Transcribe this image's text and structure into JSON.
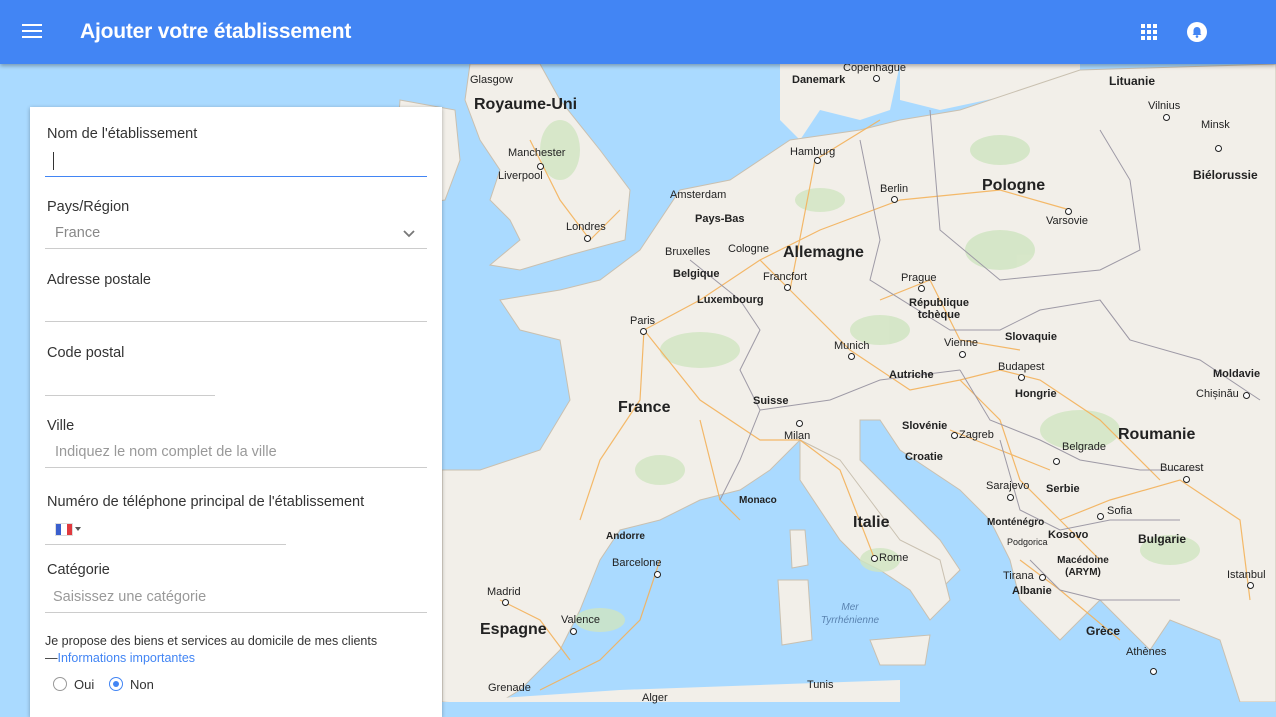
{
  "header": {
    "title": "Ajouter votre établissement",
    "menu_icon": "hamburger-menu-icon",
    "apps_icon": "apps-grid-icon",
    "notification_icon": "notification-bell-icon",
    "bar_color": "#4285f4"
  },
  "form": {
    "name": {
      "label": "Nom de l'établissement",
      "value": ""
    },
    "country": {
      "label": "Pays/Région",
      "value": "France",
      "icon": "chevron-down-icon"
    },
    "address": {
      "label": "Adresse postale",
      "value": ""
    },
    "postal": {
      "label": "Code postal",
      "value": ""
    },
    "city": {
      "label": "Ville",
      "placeholder": "Indiquez le nom complet de la ville"
    },
    "phone": {
      "label": "Numéro de téléphone principal de l'établissement",
      "flag_icon": "france-flag-icon"
    },
    "category": {
      "label": "Catégorie",
      "placeholder": "Saisissez une catégorie"
    },
    "service_area": {
      "text": "Je propose des biens et services au domicile de mes clients",
      "prefix": "—",
      "link": "Informations importantes",
      "options": [
        {
          "label": "Oui",
          "checked": false
        },
        {
          "label": "Non",
          "checked": true
        }
      ]
    },
    "accent_color": "#4285f4"
  },
  "map": {
    "countries": [
      "Royaume-Uni",
      "Allemagne",
      "Pologne",
      "France",
      "Italie",
      "Espagne",
      "Roumanie",
      "Lituanie",
      "Biélorussie",
      "République tchèque",
      "Slovaquie",
      "Hongrie",
      "Autriche",
      "Suisse",
      "Belgique",
      "Pays-Bas",
      "Luxembourg",
      "Danemark",
      "Slovénie",
      "Croatie",
      "Serbie",
      "Bulgarie",
      "Grèce",
      "Albanie",
      "Kosovo",
      "Monténégro",
      "Macédoine (ARYM)",
      "Moldavie",
      "Andorre",
      "Monaco"
    ],
    "cities": [
      "Glasgow",
      "Manchester",
      "Liverpool",
      "Londres",
      "Amsterdam",
      "Bruxelles",
      "Cologne",
      "Francfort",
      "Hamburg",
      "Berlin",
      "Copenhague",
      "Paris",
      "Munich",
      "Prague",
      "Vienne",
      "Budapest",
      "Varsovie",
      "Vilnius",
      "Minsk",
      "Zagreb",
      "Milan",
      "Rome",
      "Barcelone",
      "Madrid",
      "Valence",
      "Grenade",
      "Belgrade",
      "Sarajevo",
      "Sofia",
      "Bucarest",
      "Chișinău",
      "Tirana",
      "Istanbul",
      "Athènes",
      "Podgorica",
      "Tunis",
      "Alger"
    ],
    "sea": "Mer Tyrrhénienne",
    "land_color": "#f2efe9",
    "water_color": "#aadaff"
  }
}
